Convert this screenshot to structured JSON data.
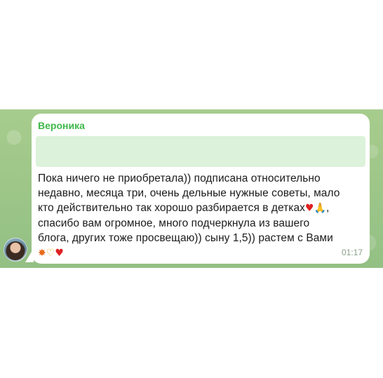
{
  "message": {
    "sender": "Вероника",
    "line1": "Пока ничего не приобретала)) подписана относительно",
    "line2": "недавно, месяца три, очень дельные нужные советы, мало",
    "line3": "кто действительно так хорошо разбирается в детках",
    "line4": "спасибо вам огромное, много подчеркнула из вашего",
    "line5": "блога, других тоже просвещаю)) сыну 1,5)) растем с Вами",
    "time": "01:17",
    "emoji_heart": "♥",
    "emoji_pray": "🙏",
    "emoji_boom": "✸",
    "emoji_hands": "♡",
    "comma": ","
  },
  "colors": {
    "background": "#9cc58a",
    "bubble": "#ffffff",
    "sender": "#3fb84a",
    "reply_box": "#dcf2da"
  },
  "icons": {
    "avatar": "user-avatar-photo"
  }
}
